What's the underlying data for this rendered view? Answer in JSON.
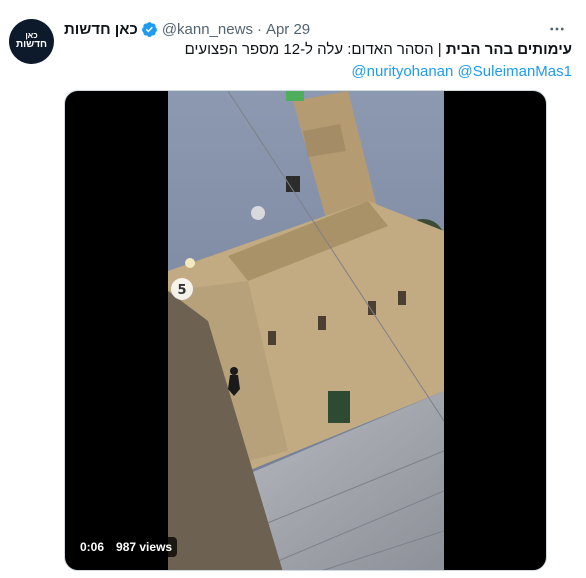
{
  "author": {
    "avatar_line1": "כאן",
    "avatar_line2": "חדשות",
    "name": "כאן חדשות",
    "handle": "@kann_news",
    "separator": "·",
    "date": "Apr 29",
    "verified": true
  },
  "tweet": {
    "headline": "עימותים בהר הבית",
    "divider": " | ",
    "body": "הסהר האדום: עלה ל-12 מספר הפצועים",
    "mentions": [
      "@nurityohanan",
      "@SuleimanMas1"
    ]
  },
  "video": {
    "timestamp": "0:06",
    "views": "987 views",
    "watermark_icon": "kan-logo-icon"
  },
  "icons": {
    "verified": "verified-badge-icon",
    "more": "more-options-icon"
  },
  "colors": {
    "accent": "#1d9bf0",
    "text": "#0f1419",
    "secondary": "#536471"
  }
}
